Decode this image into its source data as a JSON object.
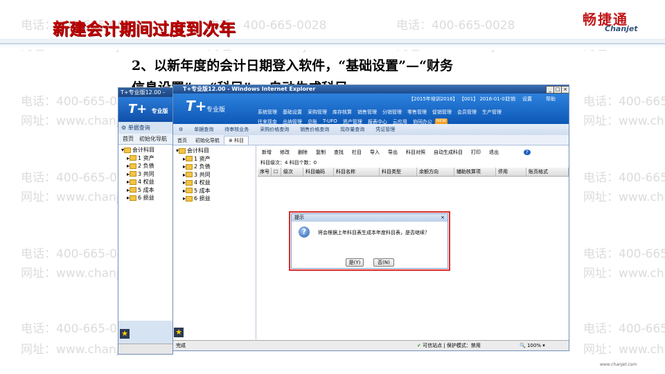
{
  "slide": {
    "title": "新建会计期间过度到次年",
    "brand_cn": "畅捷通",
    "brand_en": "Chanjet",
    "instruction_line1": "2、以新年度的会计日期登入软件，“基础设置”—“财务",
    "instruction_line2": "信息设置”— “科目”— 自动生成科目",
    "footer_site": "www.chanjet.com"
  },
  "watermark": {
    "phone": "电话：400-665-0028",
    "url": "网址：www.chanjet.net"
  },
  "back_window": {
    "title": "T+专业版12.00 -",
    "logo": "T+",
    "logo_sub": "专业版",
    "nav_query": "单据查询",
    "tabs": [
      "首页",
      "初始化导航"
    ],
    "tree": [
      "会计科目",
      "1 资产",
      "2 负债",
      "3 共同",
      "4 权益",
      "5 成本",
      "6 损益"
    ]
  },
  "main_window": {
    "title": "T+专业版12.00 - Windows Internet Explorer",
    "logo": "T+",
    "logo_sub": "专业版",
    "header_info": "【2015年培训2016】 【001】 2016-01-01",
    "logout": "注销",
    "settings": "设置",
    "help": "帮助",
    "modules_row1": [
      "系统管理",
      "基础设置",
      "采购管理",
      "库存核算",
      "销售管理",
      "分销管理",
      "零售管理",
      "促销管理",
      "会员管理",
      "生产管理"
    ],
    "modules_row2": [
      "往来现金",
      "出纳管理",
      "总账",
      "T-UFO",
      "资产管理",
      "报表中心",
      "云应用",
      "协同办公"
    ],
    "new_badge": "NEW",
    "quickbar": [
      "单据查询",
      "待审核业务",
      "采购价格查询",
      "销售价格查询",
      "现存量查询",
      "凭证管理"
    ],
    "tabs": [
      "首页",
      "初始化导航",
      "科目"
    ],
    "tree": [
      "会计科目",
      "1 资产",
      "2 负债",
      "3 共同",
      "4 权益",
      "5 成本",
      "6 损益"
    ],
    "toolbar": [
      "新增",
      "修改",
      "删除",
      "复制",
      "查找",
      "栏目",
      "导入",
      "导出",
      "科目对照",
      "自动生成科目",
      "打印",
      "退出"
    ],
    "count_line": "科目级次：4   科目个数：0",
    "grid_headers": [
      "序号",
      "",
      "级次",
      "科目编码",
      "科目名称",
      "科目类型",
      "余额方向",
      "辅助核算项",
      "停用",
      "账页格式"
    ],
    "status_left": "完成",
    "status_right": "可信站点 | 保护模式：禁用",
    "status_zoom": "100%"
  },
  "dialog": {
    "title": "提示",
    "close": "×",
    "message": "将会根据上年科目表生成本年度科目表，是否继续？",
    "yes": "是(Y)",
    "no": "否(N)"
  }
}
